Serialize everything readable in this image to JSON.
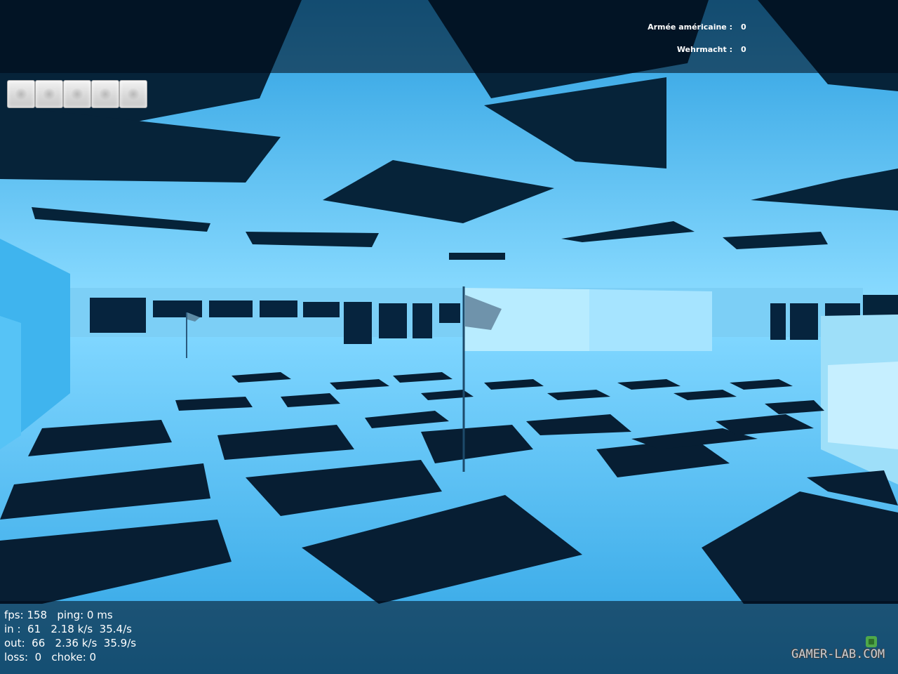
{
  "scoreboard": {
    "teams": [
      {
        "name": "Armée américaine :",
        "score": "0"
      },
      {
        "name": "Wehrmacht :",
        "score": "0"
      }
    ]
  },
  "inventory": {
    "slot_count": 5
  },
  "netgraph": {
    "lines": [
      "fps: 158   ping: 0 ms",
      "in :  61   2.18 k/s  35.4/s",
      "out:  66   2.36 k/s  35.9/s",
      "loss:  0   choke: 0"
    ]
  },
  "watermark": {
    "text": "GAMER-LAB.COM"
  },
  "colors": {
    "glow_blue": "#35b6f4",
    "beam_light": "#8fdcff",
    "dark_pit": "#052038",
    "hud_text": "#ffffff"
  },
  "icons": {
    "flag": "flag-icon",
    "inventory_slot": "inventory-slot-icon",
    "watermark_logo": "gamerlab-logo-icon"
  }
}
